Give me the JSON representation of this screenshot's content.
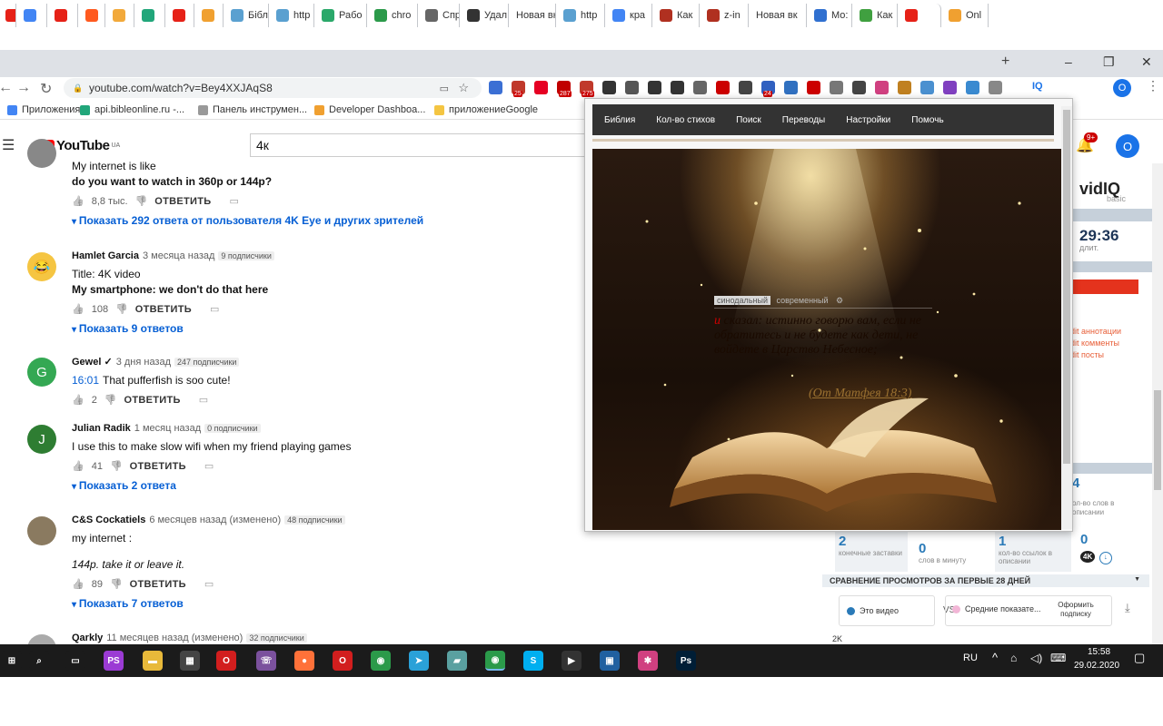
{
  "browser": {
    "tabs": [
      {
        "label": "",
        "icon": "youtube-icon",
        "color": "#e62117"
      },
      {
        "label": "",
        "icon": "google-icon",
        "color": "#4285f4"
      },
      {
        "label": "",
        "icon": "youtube-icon",
        "color": "#e62117"
      },
      {
        "label": "",
        "icon": "mail-icon",
        "color": "#ff5a1f"
      },
      {
        "label": "",
        "icon": "pencil-icon",
        "color": "#f2a93b"
      },
      {
        "label": "",
        "icon": "gem-icon",
        "color": "#21a67a"
      },
      {
        "label": "",
        "icon": "youtube-icon",
        "color": "#e62117"
      },
      {
        "label": "",
        "icon": "rainbow-icon",
        "color": "#f0a030"
      },
      {
        "label": "Бібл",
        "icon": "book-icon",
        "color": "#5aa0d0"
      },
      {
        "label": "http",
        "icon": "book-icon",
        "color": "#5aa0d0"
      },
      {
        "label": "Рабо",
        "icon": "v-icon",
        "color": "#2aa86a"
      },
      {
        "label": "chro",
        "icon": "chrome-icon",
        "color": "#2b9a4a"
      },
      {
        "label": "Спр",
        "icon": "globe-icon",
        "color": "#666666"
      },
      {
        "label": "Удал",
        "icon": "book-icon",
        "color": "#333333"
      },
      {
        "label": "Новая вк",
        "icon": "",
        "color": ""
      },
      {
        "label": "http",
        "icon": "book-icon",
        "color": "#5aa0d0"
      },
      {
        "label": "кра",
        "icon": "google-icon",
        "color": "#4285f4"
      },
      {
        "label": "Как",
        "icon": "brick-icon",
        "color": "#b03020"
      },
      {
        "label": "z-in",
        "icon": "brick-icon",
        "color": "#b03020"
      },
      {
        "label": "Новая вк",
        "icon": "",
        "color": ""
      },
      {
        "label": "Мо:",
        "icon": "m-icon",
        "color": "#3070d0"
      },
      {
        "label": "Как",
        "icon": "house-icon",
        "color": "#40a040"
      },
      {
        "label": "",
        "icon": "youtube-icon",
        "color": "#e62117"
      },
      {
        "label": "Onl",
        "icon": "rainbow-icon",
        "color": "#f0a030"
      }
    ],
    "new_tab": "+",
    "minimize": "–",
    "maximize": "❐",
    "close": "✕",
    "url": "youtube.com/watch?v=Bey4XXJAqS8",
    "profile_initial": "O",
    "ext_badges": [
      "25",
      "287",
      "275",
      "24"
    ],
    "ext_iq": "IQ",
    "bookmarks": [
      {
        "label": "Приложения",
        "color": "#4285f4"
      },
      {
        "label": "api.bibleonline.ru -...",
        "color": "#21a67a"
      },
      {
        "label": "Панель инструмен...",
        "color": "#999999"
      },
      {
        "label": "Developer Dashboa...",
        "color": "#f0a030"
      },
      {
        "label": "приложениеGoogle",
        "color": "#f4c542"
      }
    ]
  },
  "youtube": {
    "logo": "YouTube",
    "region": "UA",
    "search_value": "4к",
    "notif_count": "9+",
    "avatar_initial": "O",
    "comments": [
      {
        "author": "",
        "time": "",
        "subs": "",
        "avatar": "",
        "avatar_color": "#888888",
        "lines": [
          "My internet is like",
          "do you want to watch in 360p or 144p?"
        ],
        "likes": "8,8 тыс.",
        "reply": "ОТВЕТИТЬ",
        "show_replies": "Показать 292 ответа от пользователя 4K Eye и других зрителей"
      },
      {
        "author": "Hamlet Garcia",
        "time": "3 месяца назад",
        "subs": "9 подписчики",
        "avatar": "😂",
        "avatar_color": "#f5c542",
        "lines": [
          "Title: 4K video",
          "My smartphone: we don't do that here"
        ],
        "likes": "108",
        "reply": "ОТВЕТИТЬ",
        "show_replies": "Показать 9 ответов"
      },
      {
        "author": "Gewel ✓",
        "time": "3 дня назад",
        "subs": "247 подписчики",
        "avatar": "G",
        "avatar_color": "#34a853",
        "timestamp": "16:01",
        "lines": [
          "That pufferfish is soo cute!"
        ],
        "likes": "2",
        "reply": "ОТВЕТИТЬ",
        "show_replies": ""
      },
      {
        "author": "Julian Radik",
        "time": "1 месяц назад",
        "subs": "0 подписчики",
        "avatar": "J",
        "avatar_color": "#2e7d32",
        "lines": [
          "I use this to make slow wifi when my friend playing games"
        ],
        "likes": "41",
        "reply": "ОТВЕТИТЬ",
        "show_replies": "Показать 2 ответа"
      },
      {
        "author": "C&S Cockatiels",
        "time": "6 месяцев назад (изменено)",
        "subs": "48 подписчики",
        "avatar": "",
        "avatar_color": "#8a7a60",
        "lines": [
          "my internet :",
          "",
          "144p. take it or leave it."
        ],
        "likes": "89",
        "reply": "ОТВЕТИТЬ",
        "show_replies": "Показать 7 ответов"
      },
      {
        "author": "Qarkly",
        "time": "11 месяцев назад (изменено)",
        "subs": "32 подписчики",
        "avatar": "",
        "avatar_color": "#aaaaaa",
        "lines": [],
        "likes": "",
        "reply": "",
        "show_replies": ""
      }
    ]
  },
  "vidiq": {
    "logo": "vidIQ",
    "tier": "basic",
    "time": "29:36",
    "time_caption": "длит.",
    "links": [
      "dit аннотации",
      "dit комменты",
      "dit посты"
    ],
    "stat_top_value": "4",
    "stat_top_caption": "ол-во слов в описании",
    "stats": [
      {
        "value": "2",
        "caption": "конечные заставки"
      },
      {
        "value": "0",
        "caption": "слов в минуту"
      },
      {
        "value": "1",
        "caption": "кол-во ссылок в описании"
      },
      {
        "value": "0",
        "caption": ""
      }
    ],
    "compare_title": "СРАВНЕНИЕ ПРОСМОТРОВ ЗА ПЕРВЫЕ 28 ДНЕЙ",
    "this_video": "Это видео",
    "vs": "VS",
    "average": "Средние показате...",
    "subscribe_btn": "Оформить подписку",
    "axis_label": "2K"
  },
  "popup": {
    "nav": [
      "Библия",
      "Кол-во стихов",
      "Поиск",
      "Переводы",
      "Настройки",
      "Помочь"
    ],
    "translation_active": "синодальный",
    "translation_other": "современный",
    "verse_marker": "и",
    "verse": "сказал: истинно говорю вам, если не обратитесь и не будете как дети, не войдете в Царство Небесное;",
    "reference": "(От Матфея 18:3)"
  },
  "taskbar": {
    "icons": [
      {
        "name": "windows-start-icon",
        "label": "⊞",
        "color": "#1b1b1b"
      },
      {
        "name": "search-icon",
        "label": "⌕",
        "color": "#1b1b1b"
      },
      {
        "name": "task-view-icon",
        "label": "▭",
        "color": "#1b1b1b"
      },
      {
        "name": "phpstorm-icon",
        "label": "PS",
        "color": "#9b3bd4"
      },
      {
        "name": "file-explorer-icon",
        "label": "▬",
        "color": "#e8b93a"
      },
      {
        "name": "calculator-icon",
        "label": "▦",
        "color": "#444444"
      },
      {
        "name": "opera-red-icon",
        "label": "O",
        "color": "#d21e1e"
      },
      {
        "name": "viber-icon",
        "label": "☏",
        "color": "#7b519d"
      },
      {
        "name": "firefox-icon",
        "label": "●",
        "color": "#ff7139"
      },
      {
        "name": "opera-icon",
        "label": "O",
        "color": "#d21e1e"
      },
      {
        "name": "chrome-icon",
        "label": "◉",
        "color": "#2b9a4a"
      },
      {
        "name": "telegram-icon",
        "label": "➤",
        "color": "#2aa1d8"
      },
      {
        "name": "notes-icon",
        "label": "▰",
        "color": "#5aa0a0"
      },
      {
        "name": "chrome-active-icon",
        "label": "◉",
        "color": "#2b9a4a"
      },
      {
        "name": "skype-icon",
        "label": "S",
        "color": "#00aff0"
      },
      {
        "name": "video-editor-icon",
        "label": "▶",
        "color": "#333333"
      },
      {
        "name": "screen-icon",
        "label": "▣",
        "color": "#2060a0"
      },
      {
        "name": "colorful-app-icon",
        "label": "✱",
        "color": "#d04080"
      },
      {
        "name": "photoshop-icon",
        "label": "Ps",
        "color": "#001e36"
      }
    ],
    "lang": "RU",
    "time": "15:58",
    "date": "29.02.2020"
  }
}
